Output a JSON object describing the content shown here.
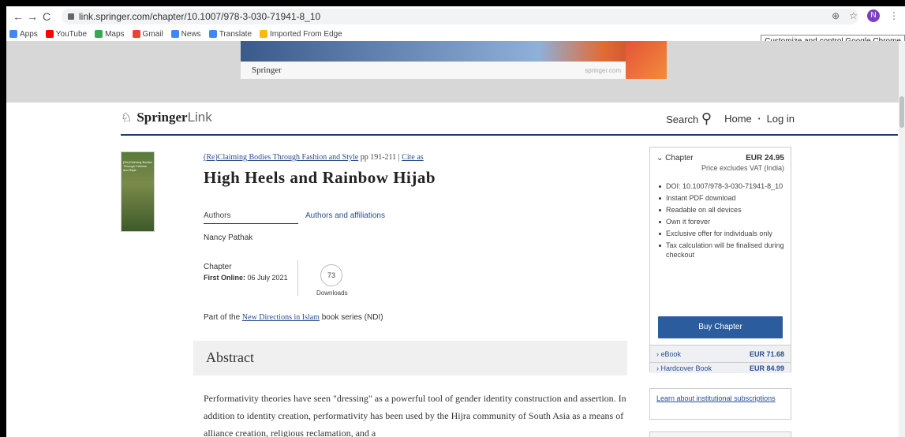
{
  "browser": {
    "url": "link.springer.com/chapter/10.1007/978-3-030-71941-8_10",
    "avatar_letter": "N",
    "tooltip": "Customize and control Google Chrome"
  },
  "bookmarks": [
    {
      "label": "Apps",
      "color": "#4285f4"
    },
    {
      "label": "YouTube",
      "color": "#ff0000"
    },
    {
      "label": "Maps",
      "color": "#34a853"
    },
    {
      "label": "Gmail",
      "color": "#ea4335"
    },
    {
      "label": "News",
      "color": "#4285f4"
    },
    {
      "label": "Translate",
      "color": "#4285f4"
    },
    {
      "label": "Imported From Edge",
      "color": "#fbbc04"
    }
  ],
  "ad": {
    "brand": "Springer",
    "site": "springer.com"
  },
  "header": {
    "logo_main": "Springer",
    "logo_sub": "Link",
    "search_label": "Search",
    "home_label": "Home",
    "separator": "•",
    "login_label": "Log in"
  },
  "chapter": {
    "book_title": "(Re)Claiming Bodies Through Fashion and Style",
    "pages": "pp 191-211",
    "cite_as": "Cite as",
    "title": "High Heels and Rainbow Hijab",
    "authors_tab": "Authors",
    "affiliations_tab": "Authors and affiliations",
    "author_name": "Nancy Pathak",
    "type": "Chapter",
    "first_online_label": "First Online:",
    "first_online_date": "06 July 2021",
    "downloads_count": "73",
    "downloads_label": "Downloads",
    "series_prefix": "Part of the",
    "series_link": "New Directions in Islam",
    "series_suffix": "book series (NDI)"
  },
  "abstract": {
    "heading": "Abstract",
    "text": "Performativity theories have seen \"dressing\" as a powerful tool of gender identity construction and assertion. In addition to identity creation, performativity has been used by the Hijra community of South Asia as a means of alliance creation, religious reclamation, and a"
  },
  "buybox": {
    "chapter_label": "Chapter",
    "chapter_price": "EUR 24.95",
    "vat_note": "Price excludes VAT (India)",
    "features": [
      "DOI: 10.1007/978-3-030-71941-8_10",
      "Instant PDF download",
      "Readable on all devices",
      "Own it forever",
      "Exclusive offer for individuals only",
      "Tax calculation will be finalised during checkout"
    ],
    "buy_button": "Buy Chapter",
    "ebook_label": "eBook",
    "ebook_price": "EUR 71.68",
    "hardcover_label": "Hardcover Book",
    "hardcover_price": "EUR 84.99"
  },
  "institutional": {
    "link": "Learn about institutional subscriptions"
  }
}
